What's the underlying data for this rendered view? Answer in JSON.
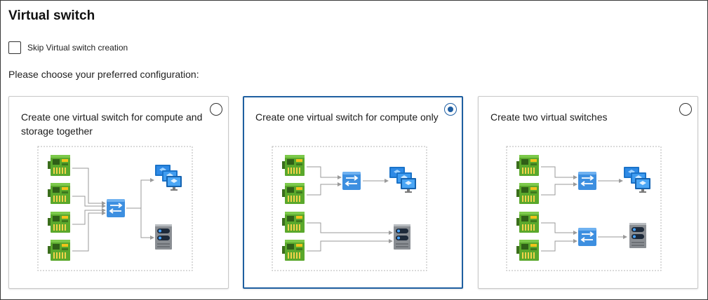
{
  "page": {
    "title": "Virtual switch"
  },
  "skip": {
    "label": "Skip Virtual switch creation",
    "checked": false
  },
  "prompt": "Please choose your preferred configuration:",
  "options": [
    {
      "title": "Create one virtual switch for compute and storage together",
      "selected": false
    },
    {
      "title": "Create one virtual switch for compute only",
      "selected": true
    },
    {
      "title": "Create two virtual switches",
      "selected": false
    }
  ],
  "colors": {
    "selected_border": "#1e5fa0",
    "radio_fill": "#1f5fa3",
    "switch_blue": "#3d8fe0",
    "nic_green": "#5aa82c",
    "vm_blue": "#1a73c9",
    "storage_gray": "#8a8e93"
  },
  "icons": {
    "nic": "network-adapter-icon",
    "switch": "virtual-switch-icon",
    "vm": "virtual-machines-icon",
    "storage": "storage-server-icon"
  }
}
